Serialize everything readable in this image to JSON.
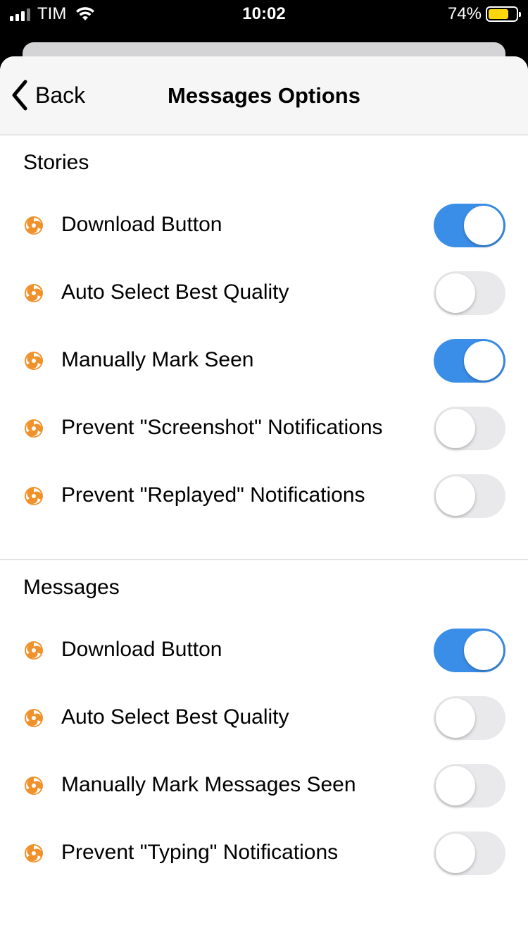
{
  "status_bar": {
    "carrier": "TIM",
    "time": "10:02",
    "battery_percent": "74%",
    "battery_level": 0.74,
    "battery_color": "#ffd60a"
  },
  "nav": {
    "back_label": "Back",
    "title": "Messages Options"
  },
  "colors": {
    "accent": "#3b8ee8",
    "icon": "#f0922c"
  },
  "sections": [
    {
      "title": "Stories",
      "rows": [
        {
          "label": "Download Button",
          "on": true
        },
        {
          "label": "Auto Select Best Quality",
          "on": false
        },
        {
          "label": "Manually Mark Seen",
          "on": true
        },
        {
          "label": "Prevent \"Screenshot\" Notifications",
          "on": false
        },
        {
          "label": "Prevent \"Replayed\" Notifications",
          "on": false
        }
      ]
    },
    {
      "title": "Messages",
      "rows": [
        {
          "label": "Download Button",
          "on": true
        },
        {
          "label": "Auto Select Best Quality",
          "on": false
        },
        {
          "label": "Manually Mark Messages Seen",
          "on": false
        },
        {
          "label": "Prevent \"Typing\" Notifications",
          "on": false
        }
      ]
    }
  ]
}
